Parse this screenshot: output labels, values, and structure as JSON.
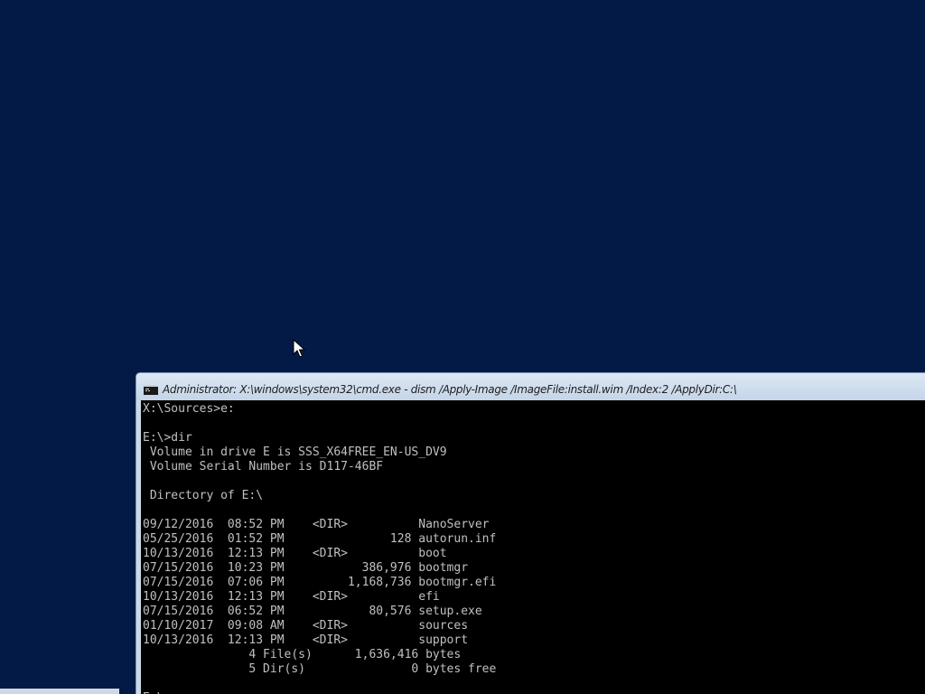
{
  "window": {
    "title": "Administrator: X:\\windows\\system32\\cmd.exe - dism  /Apply-Image /ImageFile:install.wim /Index:2 /ApplyDir:C:\\",
    "icon": "cmd-icon"
  },
  "console": {
    "lines": [
      "X:\\Sources>e:",
      "",
      "E:\\>dir",
      " Volume in drive E is SSS_X64FREE_EN-US_DV9",
      " Volume Serial Number is D117-46BF",
      "",
      " Directory of E:\\",
      "",
      "09/12/2016  08:52 PM    <DIR>          NanoServer",
      "05/25/2016  01:52 PM               128 autorun.inf",
      "10/13/2016  12:13 PM    <DIR>          boot",
      "07/15/2016  10:23 PM           386,976 bootmgr",
      "07/15/2016  07:06 PM         1,168,736 bootmgr.efi",
      "10/13/2016  12:13 PM    <DIR>          efi",
      "07/15/2016  06:52 PM            80,576 setup.exe",
      "01/10/2017  09:08 AM    <DIR>          sources",
      "10/13/2016  12:13 PM    <DIR>          support",
      "               4 File(s)      1,636,416 bytes",
      "               5 Dir(s)               0 bytes free",
      "",
      "E:\\>_"
    ]
  },
  "colors": {
    "desktop_background": "#021a45",
    "console_background": "#000000",
    "console_text": "#c0c0c0",
    "titlebar": "#d6e3f1"
  }
}
